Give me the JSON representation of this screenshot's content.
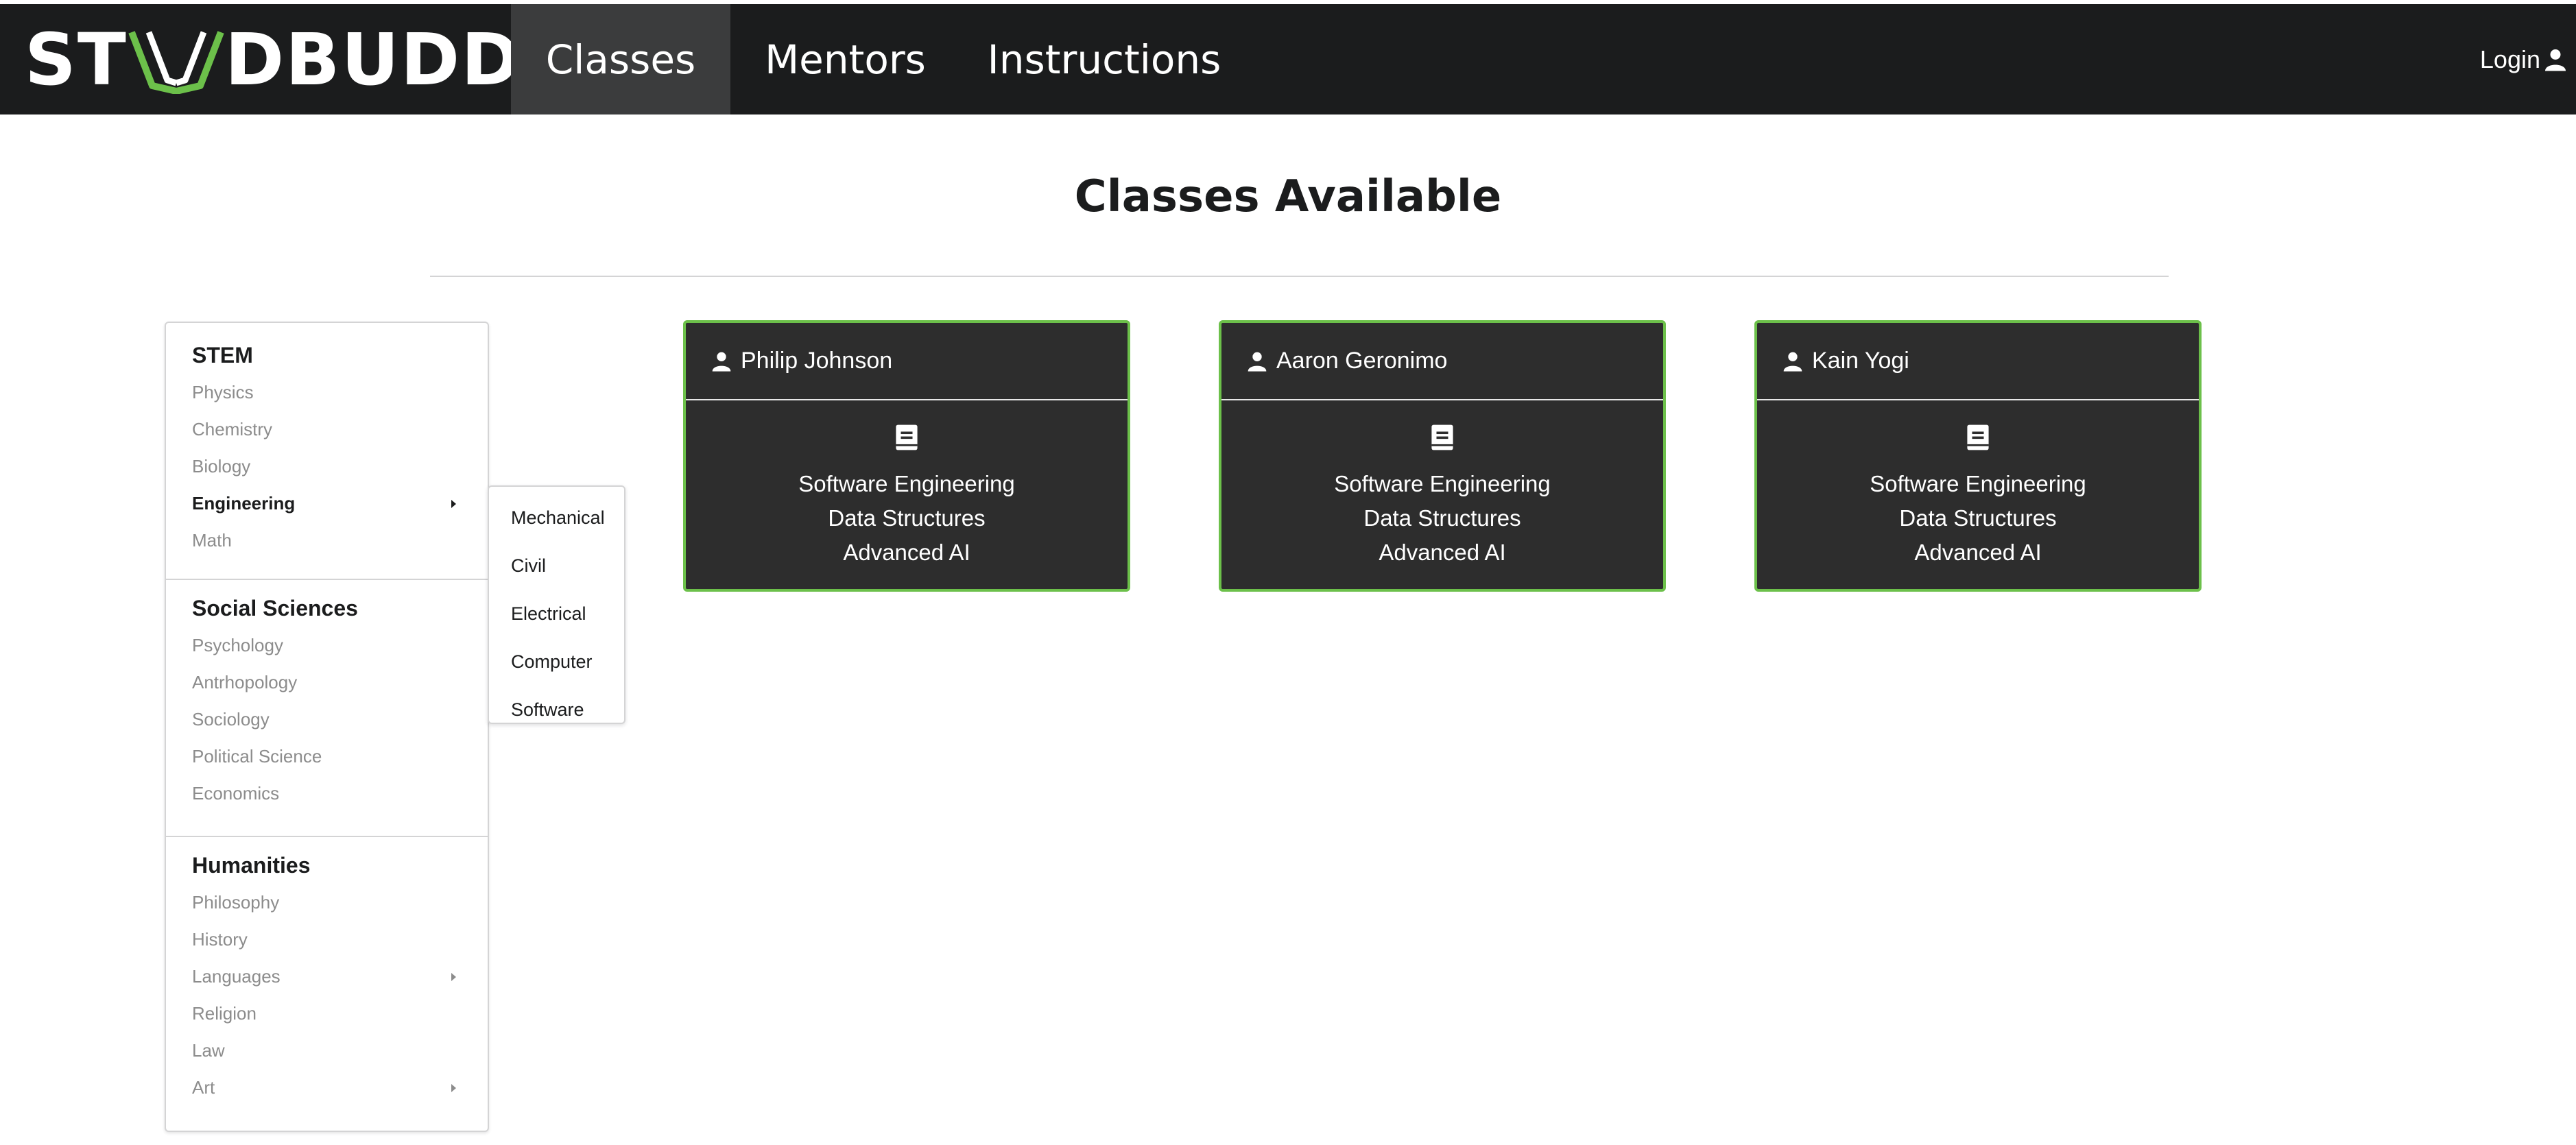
{
  "brand": {
    "logo_text_left": "ST",
    "logo_text_right": "DBUDD",
    "accent": "#6cc04a"
  },
  "nav": {
    "items": [
      {
        "label": "Classes",
        "active": true
      },
      {
        "label": "Mentors",
        "active": false
      },
      {
        "label": "Instructions",
        "active": false
      }
    ],
    "login_label": "Login"
  },
  "page": {
    "title": "Classes Available"
  },
  "sidebar": {
    "sections": [
      {
        "header": "STEM",
        "items": [
          {
            "label": "Physics"
          },
          {
            "label": "Chemistry"
          },
          {
            "label": "Biology"
          },
          {
            "label": "Engineering",
            "active": true,
            "has_submenu": true
          },
          {
            "label": "Math"
          }
        ]
      },
      {
        "header": "Social Sciences",
        "items": [
          {
            "label": "Psychology"
          },
          {
            "label": "Antrhopology"
          },
          {
            "label": "Sociology"
          },
          {
            "label": "Political Science"
          },
          {
            "label": "Economics"
          }
        ]
      },
      {
        "header": "Humanities",
        "items": [
          {
            "label": "Philosophy"
          },
          {
            "label": "History"
          },
          {
            "label": "Languages",
            "has_submenu": true
          },
          {
            "label": "Religion"
          },
          {
            "label": "Law"
          },
          {
            "label": "Art",
            "has_submenu": true
          }
        ]
      }
    ],
    "submenu": [
      "Mechanical",
      "Civil",
      "Electrical",
      "Computer",
      "Software"
    ]
  },
  "cards": [
    {
      "mentor": "Philip Johnson",
      "courses": [
        "Software Engineering",
        "Data Structures",
        "Advanced AI"
      ]
    },
    {
      "mentor": "Aaron Geronimo",
      "courses": [
        "Software Engineering",
        "Data Structures",
        "Advanced AI"
      ]
    },
    {
      "mentor": "Kain Yogi",
      "courses": [
        "Software Engineering",
        "Data Structures",
        "Advanced AI"
      ]
    }
  ],
  "colors": {
    "navbar": "#1b1c1d",
    "nav_active": "#3b3c3d",
    "card_bg": "#2d2d2d",
    "card_border": "#6cc04a",
    "muted_text": "#8c8c8c"
  },
  "icons": {
    "user": "user-icon",
    "book": "book-icon",
    "caret": "caret-right-icon",
    "logo_book": "open-book-icon"
  }
}
